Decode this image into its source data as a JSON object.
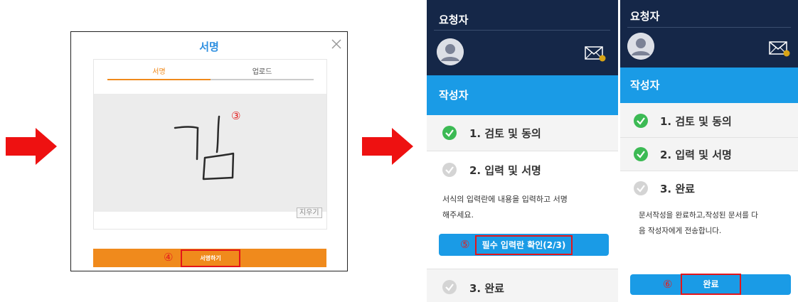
{
  "dialog": {
    "title": "서명",
    "tabs": [
      "서명",
      "업로드"
    ],
    "clear_label": "지우기",
    "sign_button": "서명하기",
    "handwriting": "김",
    "step_markers": [
      "③",
      "④"
    ]
  },
  "middle": {
    "requester": "요청자",
    "writer": "작성자",
    "steps": [
      {
        "label": "1. 검토 및 동의",
        "status": "done"
      },
      {
        "label": "2. 입력 및 서명",
        "status": "pending"
      },
      {
        "label": "3. 완료",
        "status": "pending"
      }
    ],
    "description_line1": "서식의 입력란에 내용을 입력하고 서명",
    "description_line2": "해주세요.",
    "check_button": "필수 입력란 확인(2/3)",
    "step_marker": "⑤"
  },
  "right": {
    "requester": "요청자",
    "writer": "작성자",
    "steps": [
      {
        "label": "1. 검토 및 동의",
        "status": "done"
      },
      {
        "label": "2. 입력 및 서명",
        "status": "done"
      },
      {
        "label": "3. 완료",
        "status": "pending"
      }
    ],
    "description_line1": "문서작성을 완료하고,작성된 문서를 다",
    "description_line2": "음 작성자에게 전송합니다.",
    "complete_button": "완료",
    "step_marker": "⑥"
  },
  "colors": {
    "arrow": "#ee1111",
    "header": "#152748",
    "accent_blue": "#1a9be6",
    "accent_orange": "#f08a1c",
    "check_done": "#3cba54",
    "check_todo": "#d4d4d4",
    "highlight_red": "#e3151a"
  },
  "icons": [
    "arrow-right-icon",
    "close-icon",
    "avatar-icon",
    "mail-icon",
    "check-icon"
  ]
}
